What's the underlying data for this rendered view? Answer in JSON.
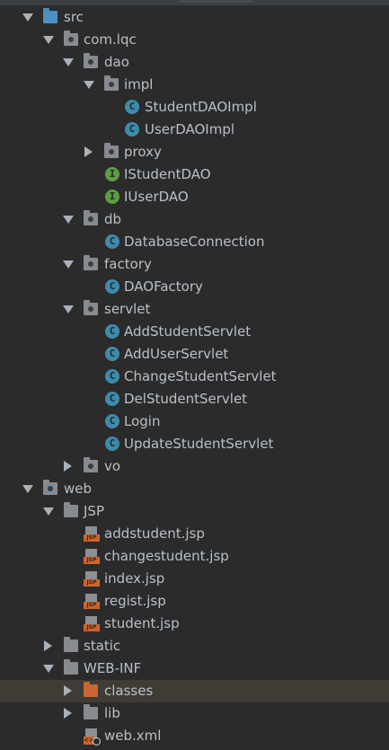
{
  "tree": {
    "src": "src",
    "com_lqc": "com.lqc",
    "dao": "dao",
    "impl": "impl",
    "StudentDAOImpl": "StudentDAOImpl",
    "UserDAOImpl": "UserDAOImpl",
    "proxy": "proxy",
    "IStudentDAO": "IStudentDAO",
    "IUserDAO": "IUserDAO",
    "db": "db",
    "DatabaseConnection": "DatabaseConnection",
    "factory": "factory",
    "DAOFactory": "DAOFactory",
    "servlet": "servlet",
    "AddStudentServlet": "AddStudentServlet",
    "AddUserServlet": "AddUserServlet",
    "ChangeStudentServlet": "ChangeStudentServlet",
    "DelStudentServlet": "DelStudentServlet",
    "Login": "Login",
    "UpdateStudentServlet": "UpdateStudentServlet",
    "vo": "vo",
    "web": "web",
    "JSP": "JSP",
    "addstudent": "addstudent.jsp",
    "changestudent": "changestudent.jsp",
    "index": "index.jsp",
    "regist": "regist.jsp",
    "student": "student.jsp",
    "static": "static",
    "WEB_INF": "WEB-INF",
    "classes": "classes",
    "lib": "lib",
    "webxml": "web.xml"
  },
  "icons": {
    "class_letter": "C",
    "interface_letter": "I",
    "jsp_tag": "JSP",
    "xml_tag": "<>"
  },
  "colors": {
    "background": "#2b2b2b",
    "selected_row": "#3f3b35",
    "source_folder": "#4f8fc0",
    "excluded_folder": "#c8672f",
    "class_icon": "#3e8bab",
    "interface_icon": "#5e9c44"
  }
}
